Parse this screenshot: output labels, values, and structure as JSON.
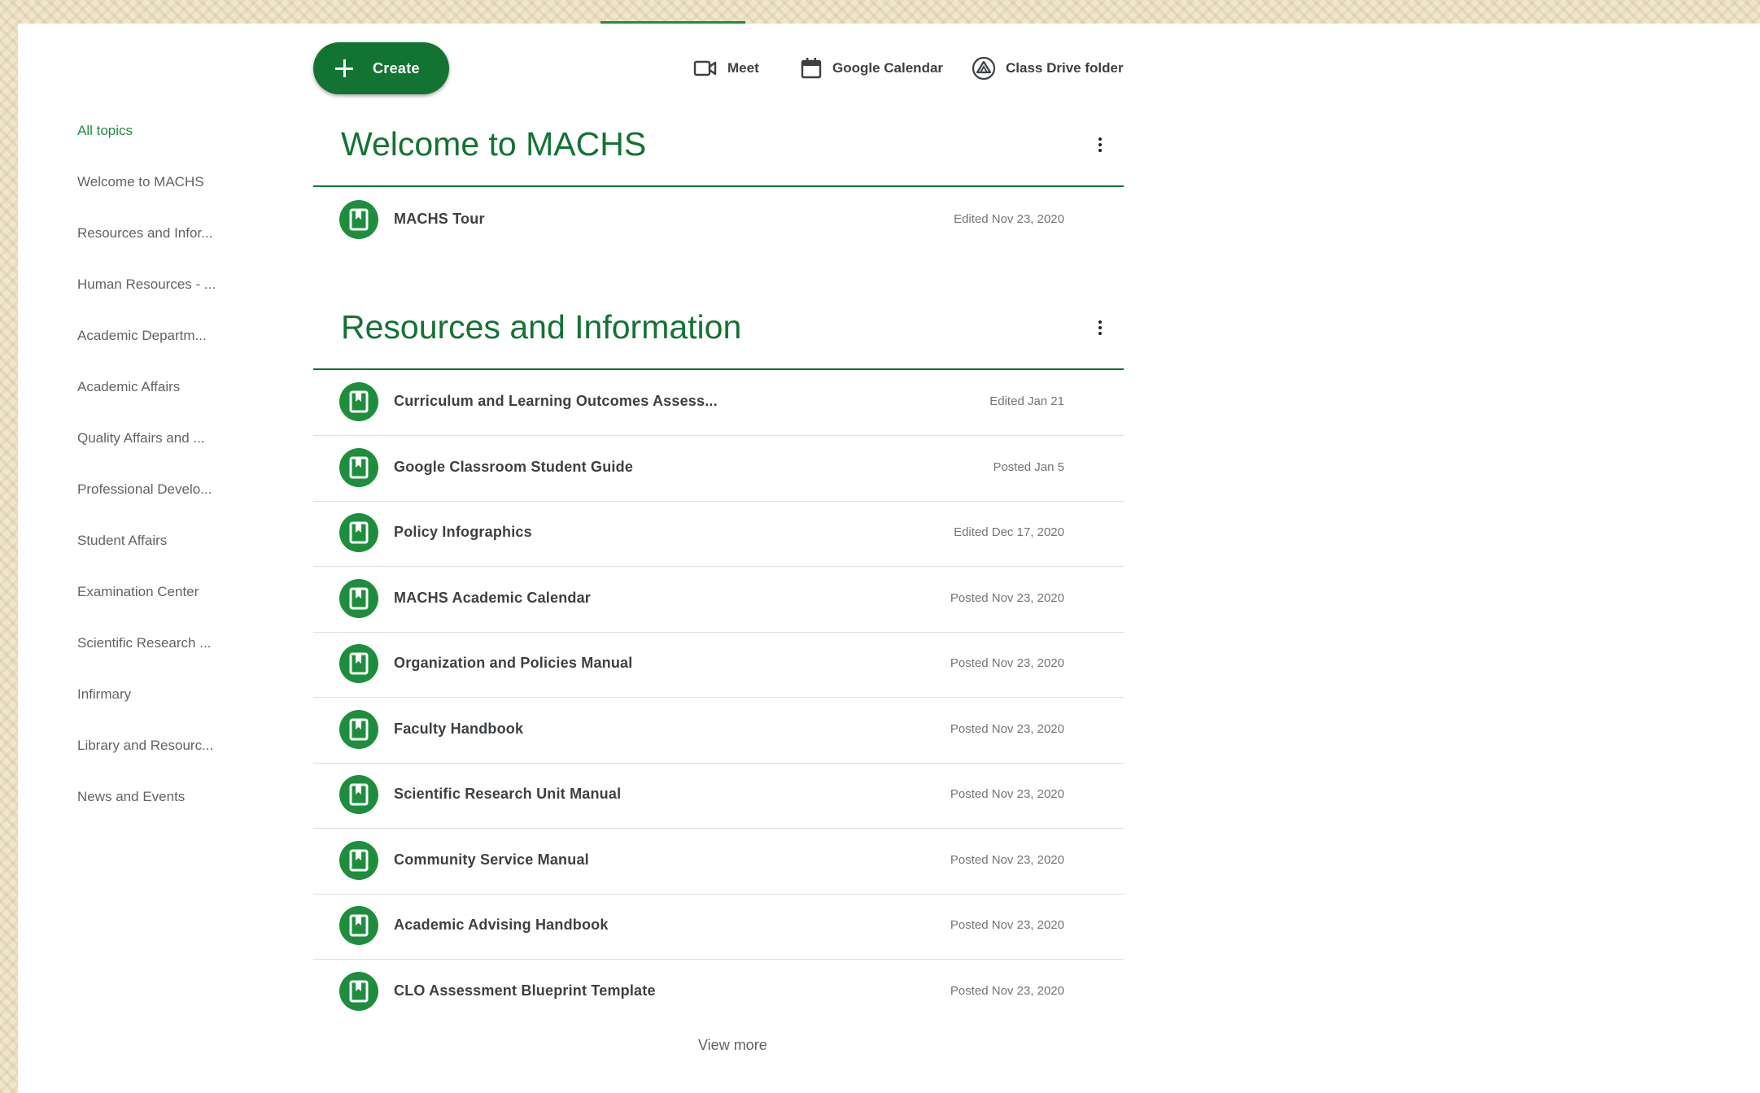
{
  "colors": {
    "accent": "#137333",
    "accent_light": "#1e8e3e",
    "background_pattern": "#efe6cf"
  },
  "sidebar": {
    "items": [
      {
        "label": "All topics",
        "active": true
      },
      {
        "label": "Welcome to MACHS"
      },
      {
        "label": "Resources and Infor..."
      },
      {
        "label": "Human Resources - ..."
      },
      {
        "label": "Academic Departm..."
      },
      {
        "label": "Academic Affairs"
      },
      {
        "label": "Quality Affairs and ..."
      },
      {
        "label": "Professional Develo..."
      },
      {
        "label": "Student Affairs"
      },
      {
        "label": "Examination Center"
      },
      {
        "label": "Scientific Research ..."
      },
      {
        "label": "Infirmary"
      },
      {
        "label": "Library and Resourc..."
      },
      {
        "label": "News and Events"
      }
    ]
  },
  "toolbar": {
    "create_label": "Create",
    "meet_label": "Meet",
    "calendar_label": "Google Calendar",
    "drive_label": "Class Drive folder",
    "icons": [
      "plus-icon",
      "video-camera-icon",
      "calendar-icon",
      "drive-icon"
    ]
  },
  "sections": [
    {
      "title": "Welcome to MACHS",
      "items": [
        {
          "title": "MACHS Tour",
          "date": "Edited Nov 23, 2020"
        }
      ]
    },
    {
      "title": "Resources and Information",
      "items": [
        {
          "title": "Curriculum and Learning Outcomes Assess...",
          "date": "Edited Jan 21"
        },
        {
          "title": "Google Classroom Student Guide",
          "date": "Posted Jan 5"
        },
        {
          "title": "Policy Infographics",
          "date": "Edited Dec 17, 2020"
        },
        {
          "title": "MACHS Academic Calendar",
          "date": "Posted Nov 23, 2020"
        },
        {
          "title": "Organization and Policies Manual",
          "date": "Posted Nov 23, 2020"
        },
        {
          "title": "Faculty Handbook",
          "date": "Posted Nov 23, 2020"
        },
        {
          "title": "Scientific Research Unit Manual",
          "date": "Posted Nov 23, 2020"
        },
        {
          "title": "Community Service Manual",
          "date": "Posted Nov 23, 2020"
        },
        {
          "title": "Academic Advising Handbook",
          "date": "Posted Nov 23, 2020"
        },
        {
          "title": "CLO Assessment Blueprint Template",
          "date": "Posted Nov 23, 2020"
        }
      ],
      "view_more_label": "View more"
    }
  ]
}
